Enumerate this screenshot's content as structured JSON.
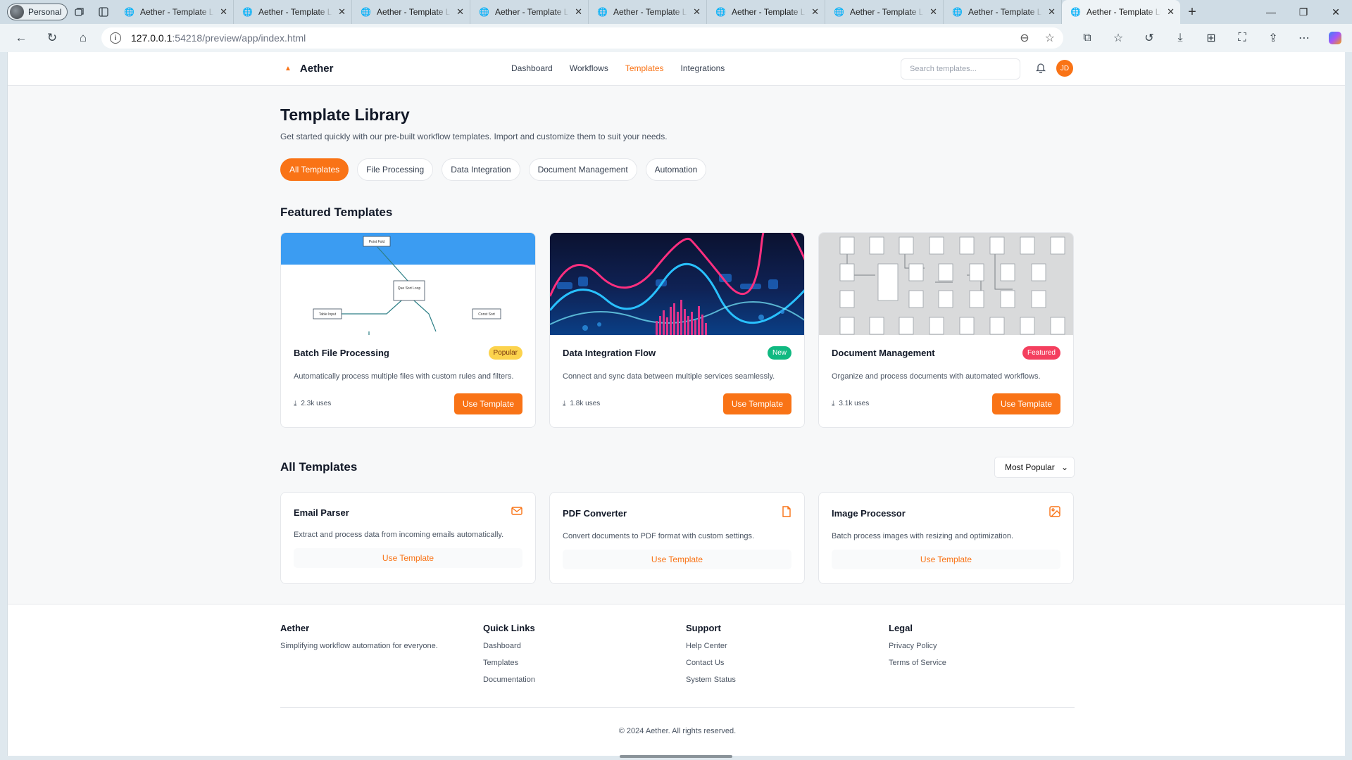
{
  "browser": {
    "profile": "Personal",
    "tabs": [
      "Aether - Template Library",
      "Aether - Template Library",
      "Aether - Template Library",
      "Aether - Template Library",
      "Aether - Template Library",
      "Aether - Template Library",
      "Aether - Template Library",
      "Aether - Template Library",
      "Aether - Template Library"
    ],
    "url_host": "127.0.0.1",
    "url_path": ":54218/preview/app/index.html"
  },
  "app": {
    "brand": "Aether",
    "nav": [
      "Dashboard",
      "Workflows",
      "Templates",
      "Integrations"
    ],
    "active_nav": "Templates",
    "search_placeholder": "Search templates...",
    "avatar": "JD",
    "accent": "#f97316"
  },
  "page": {
    "title": "Template Library",
    "subtitle": "Get started quickly with our pre-built workflow templates. Import and customize them to suit your needs.",
    "filters": [
      "All Templates",
      "File Processing",
      "Data Integration",
      "Document Management",
      "Automation"
    ]
  },
  "featured": {
    "heading": "Featured Templates",
    "cards": [
      {
        "title": "Batch File Processing",
        "badge": "Popular",
        "desc": "Automatically process multiple files with custom rules and filters.",
        "uses": "2.3k uses",
        "button": "Use Template",
        "diagram": [
          "Point Fold",
          "Que Sort Loop",
          "Table Input",
          "Const Sort"
        ]
      },
      {
        "title": "Data Integration Flow",
        "badge": "New",
        "desc": "Connect and sync data between multiple services seamlessly.",
        "uses": "1.8k uses",
        "button": "Use Template"
      },
      {
        "title": "Document Management",
        "badge": "Featured",
        "desc": "Organize and process documents with automated workflows.",
        "uses": "3.1k uses",
        "button": "Use Template"
      }
    ]
  },
  "all": {
    "heading": "All Templates",
    "sort": "Most Popular",
    "cards": [
      {
        "title": "Email Parser",
        "icon": "mail-icon",
        "desc": "Extract and process data from incoming emails automatically.",
        "link": "Use Template"
      },
      {
        "title": "PDF Converter",
        "icon": "file-icon",
        "desc": "Convert documents to PDF format with custom settings.",
        "link": "Use Template"
      },
      {
        "title": "Image Processor",
        "icon": "image-icon",
        "desc": "Batch process images with resizing and optimization.",
        "link": "Use Template"
      }
    ]
  },
  "footer": {
    "brand": "Aether",
    "tagline": "Simplifying workflow automation for everyone.",
    "quick_title": "Quick Links",
    "quick": [
      "Dashboard",
      "Templates",
      "Documentation"
    ],
    "support_title": "Support",
    "support": [
      "Help Center",
      "Contact Us",
      "System Status"
    ],
    "legal_title": "Legal",
    "legal": [
      "Privacy Policy",
      "Terms of Service"
    ],
    "copyright": "© 2024 Aether. All rights reserved."
  }
}
